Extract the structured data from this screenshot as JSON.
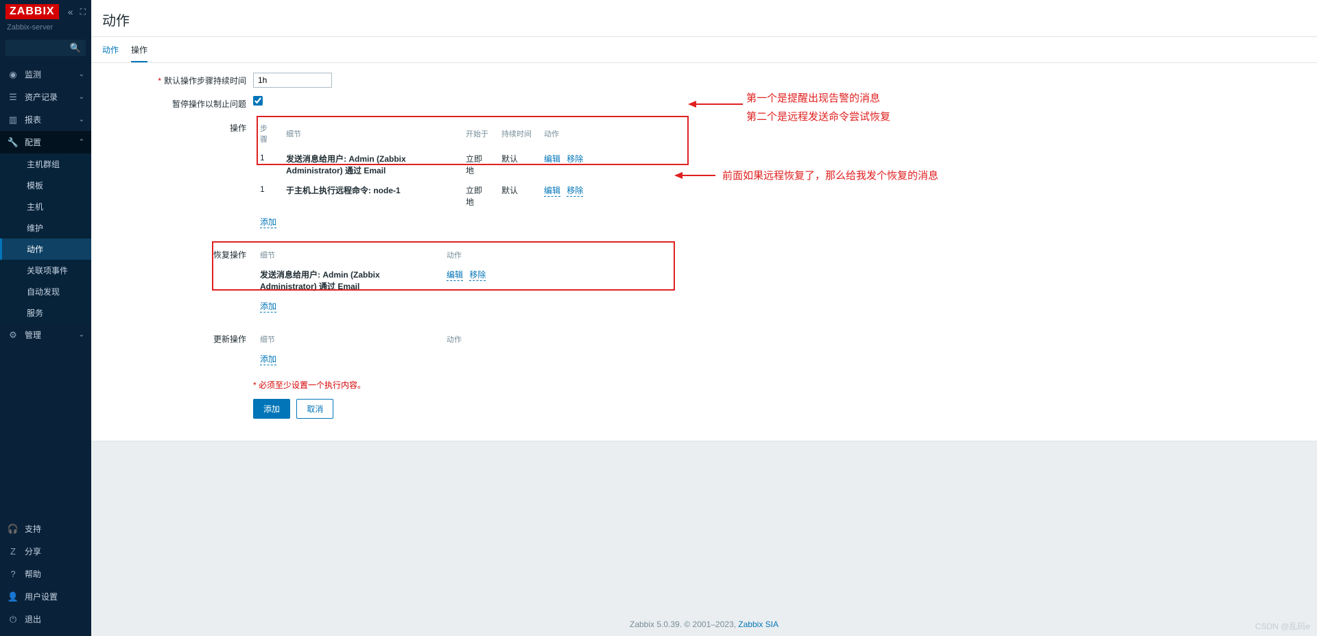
{
  "brand": "ZABBIX",
  "server_name": "Zabbix-server",
  "search_placeholder": "",
  "nav": {
    "monitor": "监测",
    "inventory": "资产记录",
    "reports": "报表",
    "config": "配置",
    "admin": "管理"
  },
  "config_sub": {
    "hostgroups": "主机群组",
    "templates": "模板",
    "hosts": "主机",
    "maintenance": "维护",
    "actions": "动作",
    "correlation": "关联项事件",
    "discovery": "自动发现",
    "services": "服务"
  },
  "footer_nav": {
    "support": "支持",
    "share": "分享",
    "help": "帮助",
    "user": "用户设置",
    "logout": "退出"
  },
  "page_title": "动作",
  "tabs": {
    "action": "动作",
    "operation": "操作"
  },
  "form": {
    "default_duration_label": "默认操作步骤持续时间",
    "default_duration_value": "1h",
    "pause_label": "暂停操作以制止问题",
    "pause_checked": true,
    "ops_label": "操作",
    "ops_headers": {
      "steps": "步骤",
      "details": "细节",
      "start": "开始于",
      "duration": "持续时间",
      "action": "动作"
    },
    "ops_rows": [
      {
        "step": "1",
        "details": "发送消息给用户: Admin (Zabbix Administrator) 通过 Email",
        "start": "立即地",
        "duration": "默认"
      },
      {
        "step": "1",
        "details": "于主机上执行远程命令: node-1",
        "start": "立即地",
        "duration": "默认"
      }
    ],
    "recovery_label": "恢复操作",
    "recovery_headers": {
      "details": "细节",
      "action": "动作"
    },
    "recovery_rows": [
      {
        "details": "发送消息给用户: Admin (Zabbix Administrator) 通过 Email"
      }
    ],
    "update_label": "更新操作",
    "update_headers": {
      "details": "细节",
      "action": "动作"
    },
    "add_link": "添加",
    "edit_link": "编辑",
    "remove_link": "移除",
    "hint": "必须至少设置一个执行内容。",
    "submit": "添加",
    "cancel": "取消"
  },
  "annotations": {
    "ops1": "第一个是提醒出现告警的消息",
    "ops2": "第二个是远程发送命令尝试恢复",
    "recovery": "前面如果远程恢复了，那么给我发个恢复的消息"
  },
  "footer_text": "Zabbix 5.0.39. © 2001–2023, ",
  "footer_link": "Zabbix SIA",
  "watermark": "CSDN @乱码e"
}
